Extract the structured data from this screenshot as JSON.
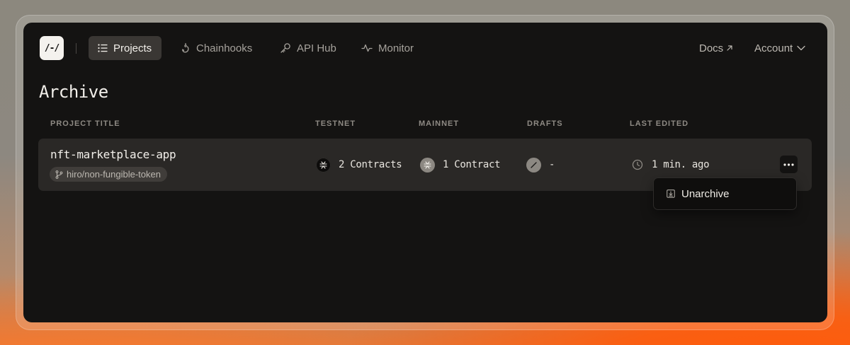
{
  "nav": {
    "logo_text": "/-/",
    "items": [
      {
        "label": "Projects",
        "icon": "list-icon",
        "active": true
      },
      {
        "label": "Chainhooks",
        "icon": "hook-icon",
        "active": false
      },
      {
        "label": "API Hub",
        "icon": "key-icon",
        "active": false
      },
      {
        "label": "Monitor",
        "icon": "activity-icon",
        "active": false
      }
    ],
    "docs_label": "Docs",
    "account_label": "Account"
  },
  "page": {
    "title": "Archive"
  },
  "table": {
    "columns": [
      "PROJECT TITLE",
      "TESTNET",
      "MAINNET",
      "DRAFTS",
      "LAST EDITED"
    ],
    "rows": [
      {
        "title": "nft-marketplace-app",
        "branch": "hiro/non-fungible-token",
        "testnet": "2 Contracts",
        "mainnet": "1 Contract",
        "drafts": "-",
        "last_edited": "1 min. ago"
      }
    ]
  },
  "context_menu": {
    "items": [
      {
        "label": "Unarchive",
        "icon": "unarchive-icon"
      }
    ]
  },
  "colors": {
    "window_bg": "#141312",
    "row_bg": "#2a2826",
    "active_nav_bg": "#3a3734",
    "accent_orange": "#ff5a0a"
  }
}
